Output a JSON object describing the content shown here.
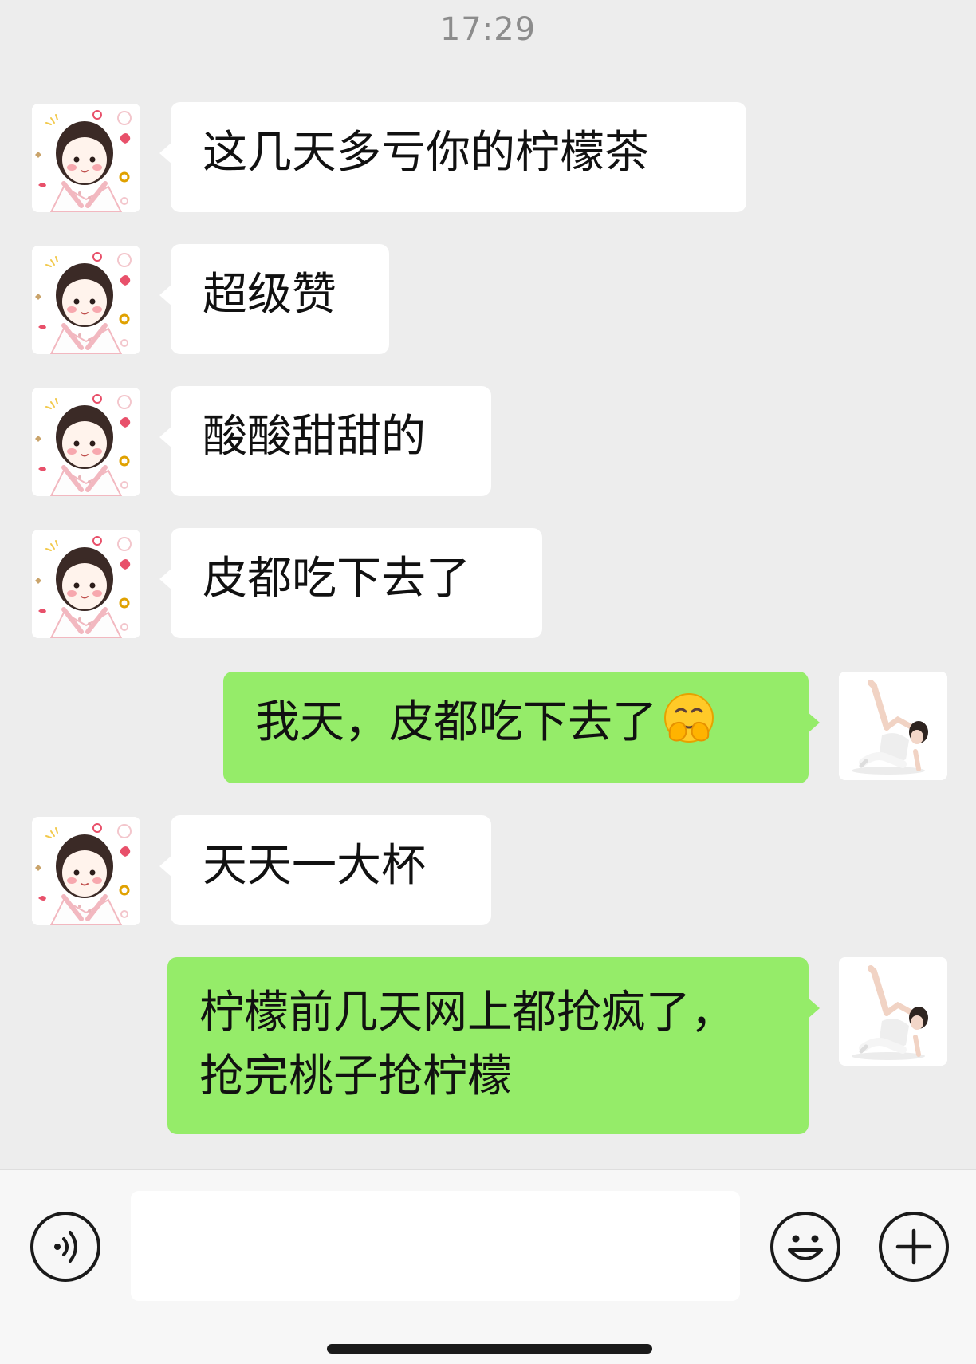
{
  "chat": {
    "timestamp": "17:29",
    "messages": [
      {
        "side": "in",
        "lines": [
          "这几天多亏你的柠檬茶"
        ]
      },
      {
        "side": "in",
        "lines": [
          "超级赞"
        ]
      },
      {
        "side": "in",
        "lines": [
          "酸酸甜甜的"
        ]
      },
      {
        "side": "in",
        "lines": [
          "皮都吃下去了"
        ]
      },
      {
        "side": "out",
        "lines": [
          "我天，皮都吃下去了"
        ],
        "emoji": "hugging-face-icon"
      },
      {
        "side": "in",
        "lines": [
          "天天一大杯"
        ]
      },
      {
        "side": "out",
        "lines": [
          "柠檬前几天网上都抢疯了，",
          "抢完桃子抢柠檬"
        ]
      }
    ]
  },
  "contact_avatar": {
    "icon": "cartoon-girl-avatar",
    "accent": "#e8506a"
  },
  "self_avatar": {
    "icon": "dancer-photo-avatar"
  },
  "colors": {
    "background": "#ededed",
    "incoming_bubble": "#ffffff",
    "outgoing_bubble": "#95ec69",
    "text": "#111111",
    "timestamp": "#8c8c8c"
  },
  "input_bar": {
    "voice_icon": "voice-icon",
    "emoji_icon": "smiley-icon",
    "plus_icon": "plus-icon",
    "input_value": "",
    "input_placeholder": ""
  }
}
